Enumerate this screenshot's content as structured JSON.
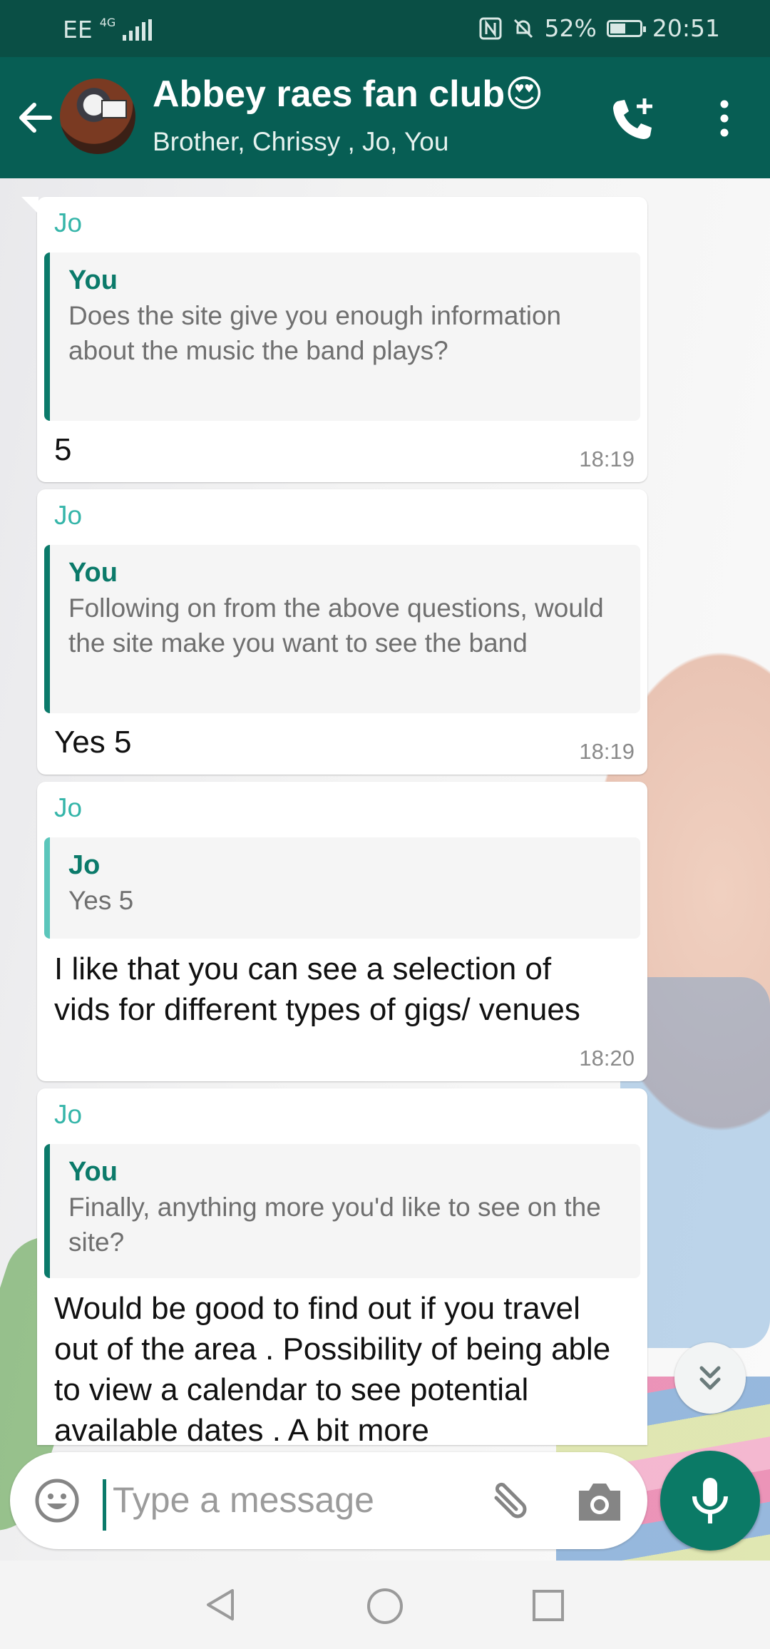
{
  "status_bar": {
    "carrier": "EE",
    "network": "4G",
    "battery": "52%",
    "battery_level": 0.52,
    "time": "20:51"
  },
  "header": {
    "title": "Abbey raes fan club😍",
    "members": "Brother, Chrissy , Jo, You"
  },
  "messages": [
    {
      "sender": "Jo",
      "quote_name": "You",
      "quote_text": "Does the site give you enough information about the music the band plays?",
      "text": "5",
      "time": "18:19"
    },
    {
      "sender": "Jo",
      "quote_name": "You",
      "quote_text": "Following on from the above questions, would the site make you want to see the band",
      "text": "Yes 5",
      "time": "18:19"
    },
    {
      "sender": "Jo",
      "quote_name": "Jo",
      "quote_text": "Yes 5",
      "text": "I like that you can see a selection of vids for different types of gigs/ venues",
      "time": "18:20"
    },
    {
      "sender": "Jo",
      "quote_name": "You",
      "quote_text": "Finally, anything more you'd like to see on the site?",
      "text": "Would be good to find out if you travel out of the area . Possibility of being able to view a calendar to see potential available dates . A bit more"
    }
  ],
  "composer": {
    "placeholder": "Type a message"
  },
  "colors": {
    "header": "#075e54",
    "accent": "#0b7a6a",
    "sender": "#35b5a9"
  },
  "icons": [
    "back-arrow-icon",
    "add-call-icon",
    "more-menu-icon",
    "emoji-icon",
    "attach-icon",
    "camera-icon",
    "mic-icon",
    "scroll-down-icon",
    "nav-back-icon",
    "nav-home-icon",
    "nav-recents-icon"
  ]
}
